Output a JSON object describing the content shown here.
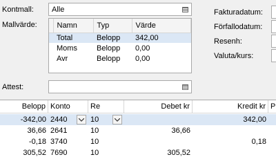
{
  "kontmall": {
    "label": "Kontmall:",
    "value": "Alle"
  },
  "mallvarde": {
    "label": "Mallvärde:",
    "columns": [
      "Namn",
      "Typ",
      "Värde"
    ],
    "rows": [
      {
        "namn": "Total",
        "typ": "Belopp",
        "varde": "342,00"
      },
      {
        "namn": "Moms",
        "typ": "Belopp",
        "varde": "0,00"
      },
      {
        "namn": "Avr",
        "typ": "Belopp",
        "varde": "0,00"
      }
    ]
  },
  "attest": {
    "label": "Attest:",
    "value": ""
  },
  "right_labels": {
    "fakturadatum": "Fakturadatum:",
    "forfallodatum": "Förfallodatum:",
    "resenh": "Resenh:",
    "valuta": "Valuta/kurs:"
  },
  "grid": {
    "headers": {
      "belopp": "Belopp",
      "konto": "Konto",
      "re": "Re",
      "debet": "Debet kr",
      "kredit": "Kredit kr",
      "p": "P"
    },
    "rows": [
      {
        "belopp": "-342,00",
        "konto": "2440",
        "re": "10",
        "debet": "",
        "kredit": "342,00"
      },
      {
        "belopp": "36,66",
        "konto": "2641",
        "re": "10",
        "debet": "36,66",
        "kredit": ""
      },
      {
        "belopp": "-0,18",
        "konto": "3740",
        "re": "10",
        "debet": "",
        "kredit": "0,18"
      },
      {
        "belopp": "305,52",
        "konto": "7690",
        "re": "10",
        "debet": "305,52",
        "kredit": ""
      }
    ]
  },
  "icons": {
    "list": "list-icon",
    "dropdown": "chevron-down-icon"
  }
}
